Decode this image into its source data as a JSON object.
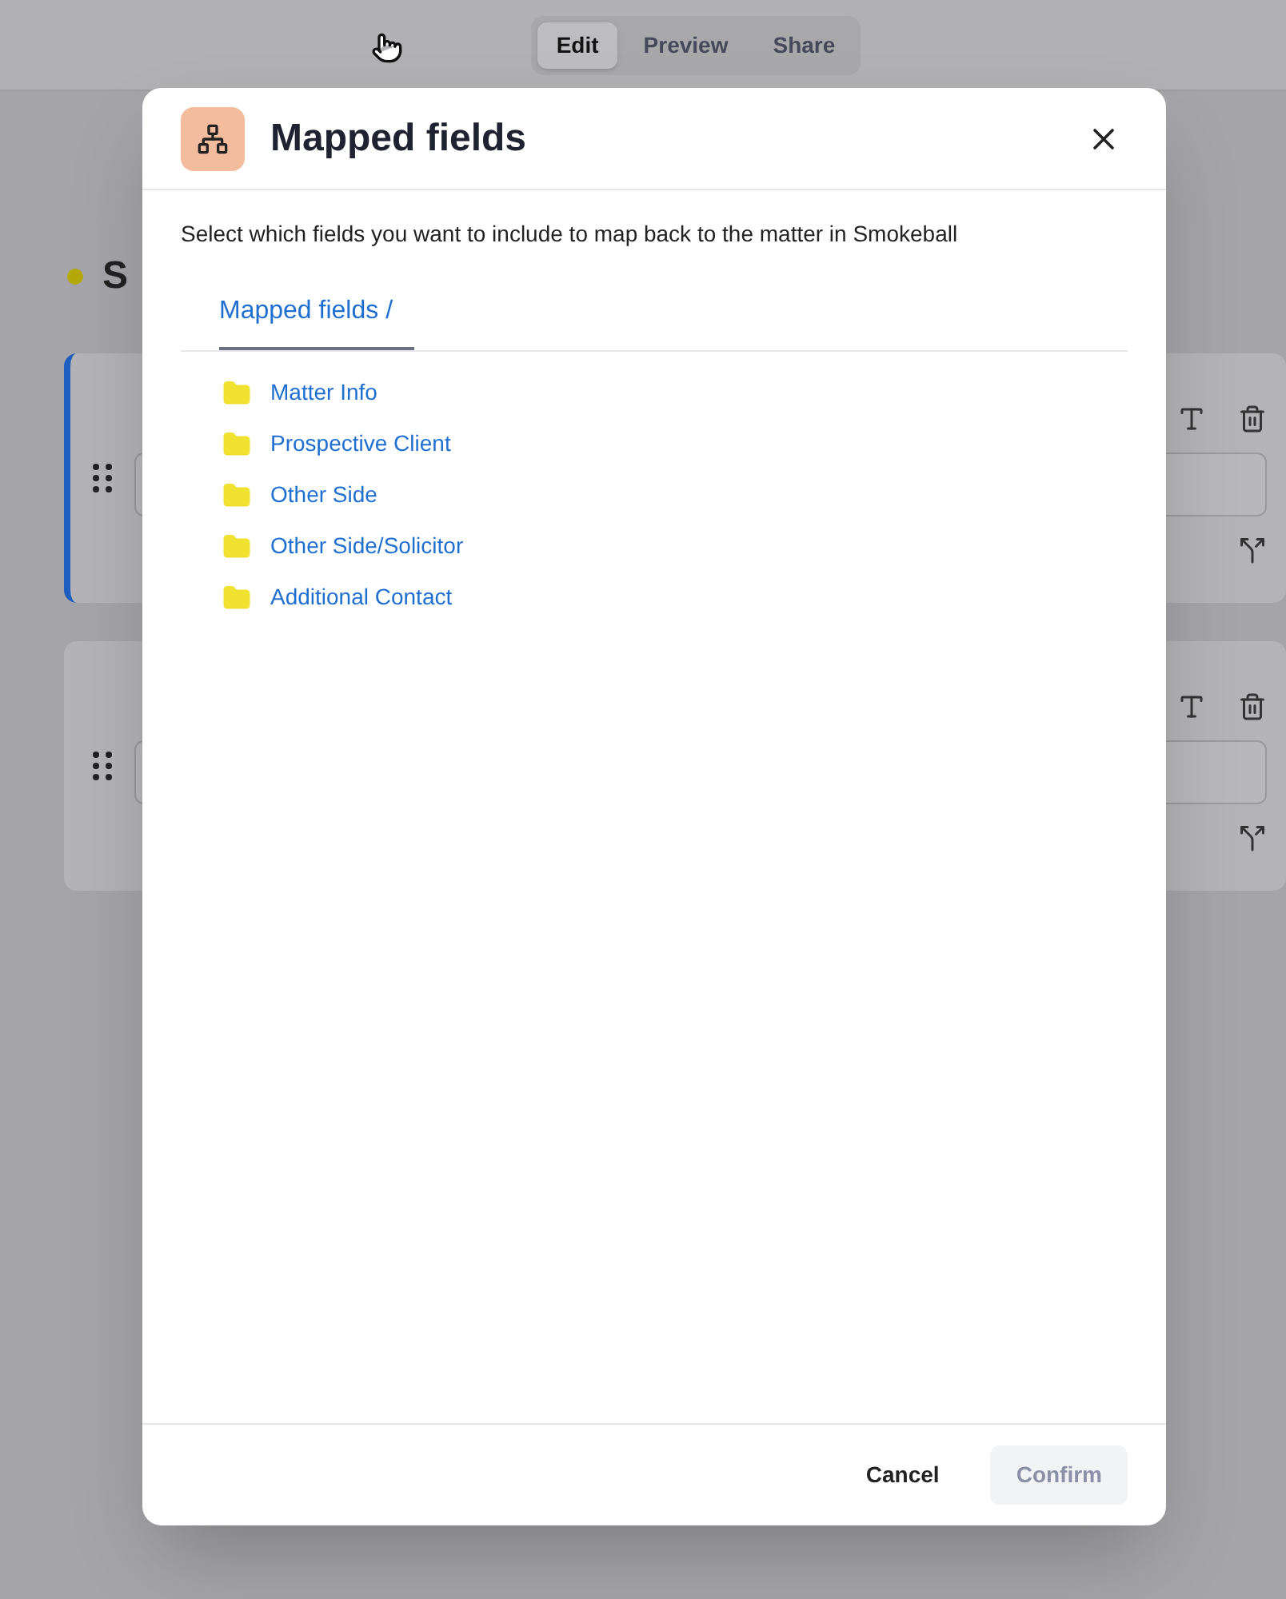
{
  "top_tabs": [
    {
      "label": "Edit",
      "selected": true
    },
    {
      "label": "Preview",
      "selected": false
    },
    {
      "label": "Share",
      "selected": false
    }
  ],
  "section": {
    "title": "S"
  },
  "cards": [
    {
      "selected": true
    },
    {
      "selected": false
    }
  ],
  "dialog": {
    "title": "Mapped fields",
    "description": "Select which fields you want to include to map back to the matter in Smokeball",
    "breadcrumb": "Mapped fields /",
    "folders": [
      {
        "label": "Matter Info"
      },
      {
        "label": "Prospective Client"
      },
      {
        "label": "Other Side"
      },
      {
        "label": "Other Side/Solicitor"
      },
      {
        "label": "Additional Contact"
      }
    ],
    "cancel": {
      "label": "Cancel"
    },
    "confirm": {
      "label": "Confirm",
      "disabled": true
    }
  }
}
